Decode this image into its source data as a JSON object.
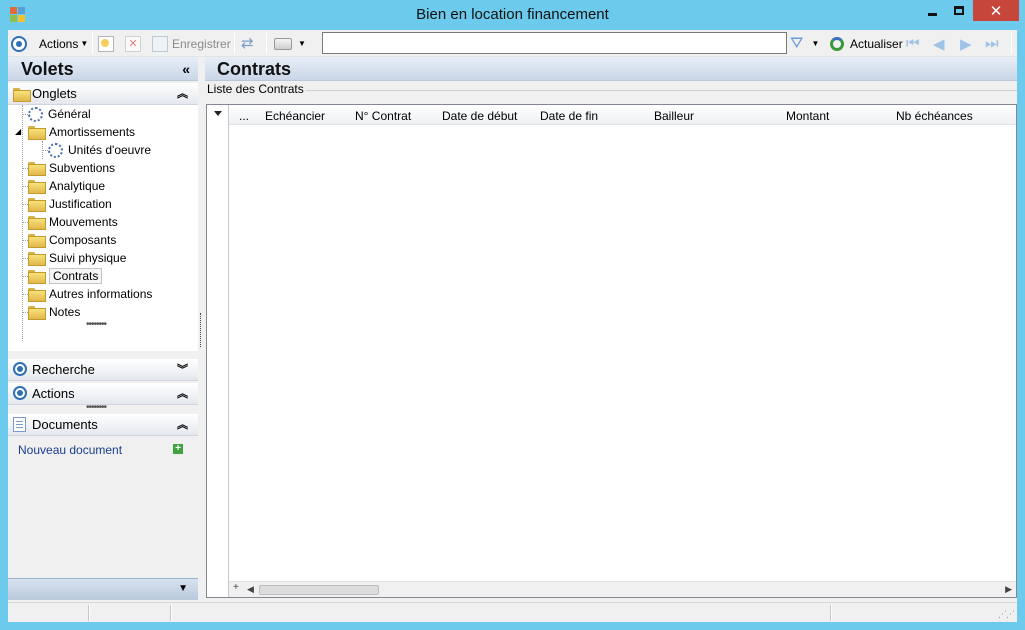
{
  "window": {
    "title": "Bien en location financement",
    "close_glyph": "✕"
  },
  "toolbar": {
    "actions_label": "Actions",
    "save_label": "Enregistrer",
    "refresh_label": "Actualiser",
    "search_value": "",
    "icons": [
      "circle-menu-icon",
      "new-doc-icon",
      "delete-icon",
      "save-icon",
      "sync-icon",
      "print-icon",
      "filter-icon",
      "refresh-icon",
      "first-icon",
      "prev-icon",
      "next-icon",
      "last-icon"
    ]
  },
  "left_pane": {
    "title": "Volets",
    "collapse_glyph": "«",
    "onglets": {
      "label": "Onglets",
      "chevron": "⌃",
      "items": [
        {
          "label": "Général",
          "icon": "gear-icon"
        },
        {
          "label": "Amortissements",
          "icon": "folder-icon",
          "expanded": true
        },
        {
          "label": "Unités d'oeuvre",
          "icon": "gear-icon",
          "child": true
        },
        {
          "label": "Subventions",
          "icon": "folder-icon"
        },
        {
          "label": "Analytique",
          "icon": "folder-icon"
        },
        {
          "label": "Justification",
          "icon": "folder-icon"
        },
        {
          "label": "Mouvements",
          "icon": "folder-icon"
        },
        {
          "label": "Composants",
          "icon": "folder-icon"
        },
        {
          "label": "Suivi physique",
          "icon": "folder-icon"
        },
        {
          "label": "Contrats",
          "icon": "folder-open-icon",
          "selected": true
        },
        {
          "label": "Autres informations",
          "icon": "folder-icon"
        },
        {
          "label": "Notes",
          "icon": "folder-icon"
        }
      ]
    },
    "recherche": {
      "label": "Recherche",
      "chevron": "⌄"
    },
    "actions": {
      "label": "Actions",
      "chevron": "⌃"
    },
    "documents": {
      "label": "Documents",
      "chevron": "⌃",
      "new_document": "Nouveau document",
      "add_glyph": "+"
    }
  },
  "main": {
    "title": "Contrats",
    "group_label": "Liste des Contrats",
    "grid": {
      "columns": [
        "...",
        "Echéancier",
        "N° Contrat",
        "Date de début",
        "Date de fin",
        "Bailleur",
        "Montant",
        "Nb échéances"
      ],
      "rows": []
    }
  },
  "colors": {
    "titlebar": "#6ccbec",
    "close_button": "#c7463b",
    "accent": "#2e6fb5"
  }
}
